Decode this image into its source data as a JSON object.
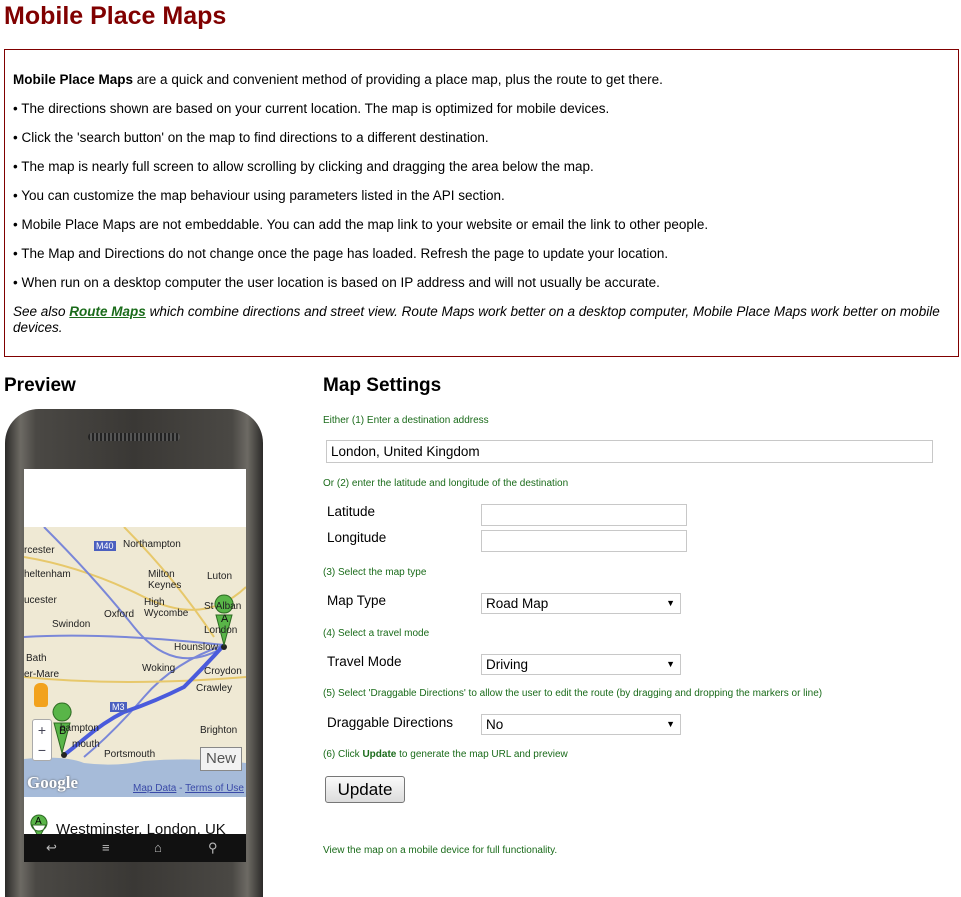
{
  "header": {
    "title": "Mobile Place Maps"
  },
  "intro": {
    "lead_bold": "Mobile Place Maps",
    "lead_rest": " are a quick and convenient method of providing a place map, plus the route to get there.",
    "bullets": [
      "• The directions shown are based on your current location. The map is optimized for mobile devices.",
      "• Click the 'search button' on the map to find directions to a different destination.",
      "• The map is nearly full screen to allow scrolling by clicking and dragging the area below the map.",
      "• You can customize the map behaviour using parameters listed in the API section.",
      "• Mobile Place Maps are not embeddable. You can add the map link to your website or email the link to other people.",
      "• The Map and Directions do not change once the page has loaded. Refresh the page to update your location.",
      "• When run on a desktop computer the user location is based on IP address and will not usually be accurate."
    ],
    "see_also_prefix": "See also ",
    "see_also_link": "Route Maps",
    "see_also_suffix": " which combine directions and street view. Route Maps work better on a desktop computer, Mobile Place Maps work better on mobile devices."
  },
  "preview": {
    "heading": "Preview",
    "map_labels": {
      "northampton": "Northampton",
      "m40": "M40",
      "rcester": "rcester",
      "heltenham": "heltenham",
      "milton_keynes": "Milton\nKeynes",
      "luton": "Luton",
      "ucester": "ucester",
      "high_wycombe": "High\nWycombe",
      "oxford": "Oxford",
      "st_alban": "St Alban",
      "swindon": "Swindon",
      "london": "London",
      "hounslow": "Hounslow",
      "bath": "Bath",
      "woking": "Woking",
      "croydon": "Croydon",
      "er_mare": "er-Mare",
      "crawley": "Crawley",
      "m3": "M3",
      "brighton": "Brighton",
      "hampton": "hampton",
      "mouth": "mouth",
      "portsmouth": "Portsmouth",
      "marker_a": "A",
      "marker_b": "B"
    },
    "map_data_link": "Map Data",
    "map_sep": " - ",
    "terms_link": "Terms of Use",
    "google_logo": "Google",
    "new_button": "New",
    "zoom_in": "+",
    "zoom_out": "−",
    "result_marker": "A",
    "result_text": "Westminster, London, UK"
  },
  "settings": {
    "heading": "Map Settings",
    "step1": "Either (1) Enter a destination address",
    "address_value": "London, United Kingdom",
    "step2": "Or (2) enter the latitude and longitude of the destination",
    "latitude_label": "Latitude",
    "latitude_value": "",
    "longitude_label": "Longitude",
    "longitude_value": "",
    "step3": "(3) Select the map type",
    "map_type_label": "Map Type",
    "map_type_value": "Road Map",
    "step4": "(4) Select a travel mode",
    "travel_mode_label": "Travel Mode",
    "travel_mode_value": "Driving",
    "step5": "(5) Select 'Draggable Directions' to allow the user to edit the route (by dragging and dropping the markers or line)",
    "draggable_label": "Draggable Directions",
    "draggable_value": "No",
    "step6_prefix": "(6) Click ",
    "step6_bold": "Update",
    "step6_suffix": " to generate the map URL and preview",
    "update_label": "Update",
    "footer_note": "View the map on a mobile device for full functionality."
  },
  "colors": {
    "title": "#800000",
    "border": "#800000",
    "step_text": "#1a6b1a",
    "route": "#4a5bdc"
  },
  "icons": {
    "dropdown": "chevron-down-icon",
    "pegman": "street-view-icon"
  }
}
